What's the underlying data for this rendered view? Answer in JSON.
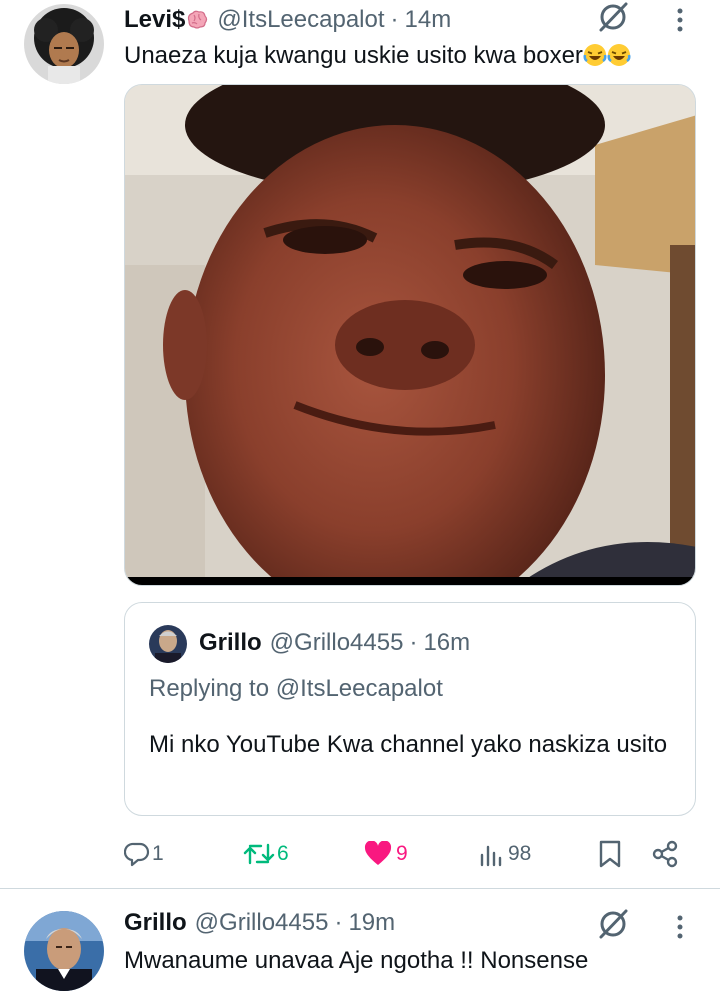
{
  "tweet1": {
    "name": "Levi$",
    "handle": "@ItsLeecapalot",
    "dot": "·",
    "time": "14m",
    "text": "Unaeza kuja kwangu uskie usito kwa boxer"
  },
  "quote": {
    "name": "Grillo",
    "handle": "@Grillo4455",
    "dot": "·",
    "time": "16m",
    "replying": "Replying to @ItsLeecapalot",
    "text": "Mi nko YouTube Kwa channel yako naskiza usito"
  },
  "actions": {
    "replies": "1",
    "reposts": "6",
    "likes": "9",
    "views": "98"
  },
  "tweet2": {
    "name": "Grillo",
    "handle": "@Grillo4455",
    "dot": "·",
    "time": "19m",
    "text": "Mwanaume unavaa Aje ngotha !! Nonsense"
  },
  "colors": {
    "text": "#0f1419",
    "secondary": "#536471",
    "retweet": "#00ba7c",
    "like": "#f91880",
    "border": "#cfd9de"
  },
  "icons": [
    "grok-icon",
    "more-icon",
    "reply-icon",
    "retweet-icon",
    "heart-icon",
    "views-icon",
    "bookmark-icon",
    "share-icon",
    "brain-emoji",
    "laughing-emoji"
  ]
}
